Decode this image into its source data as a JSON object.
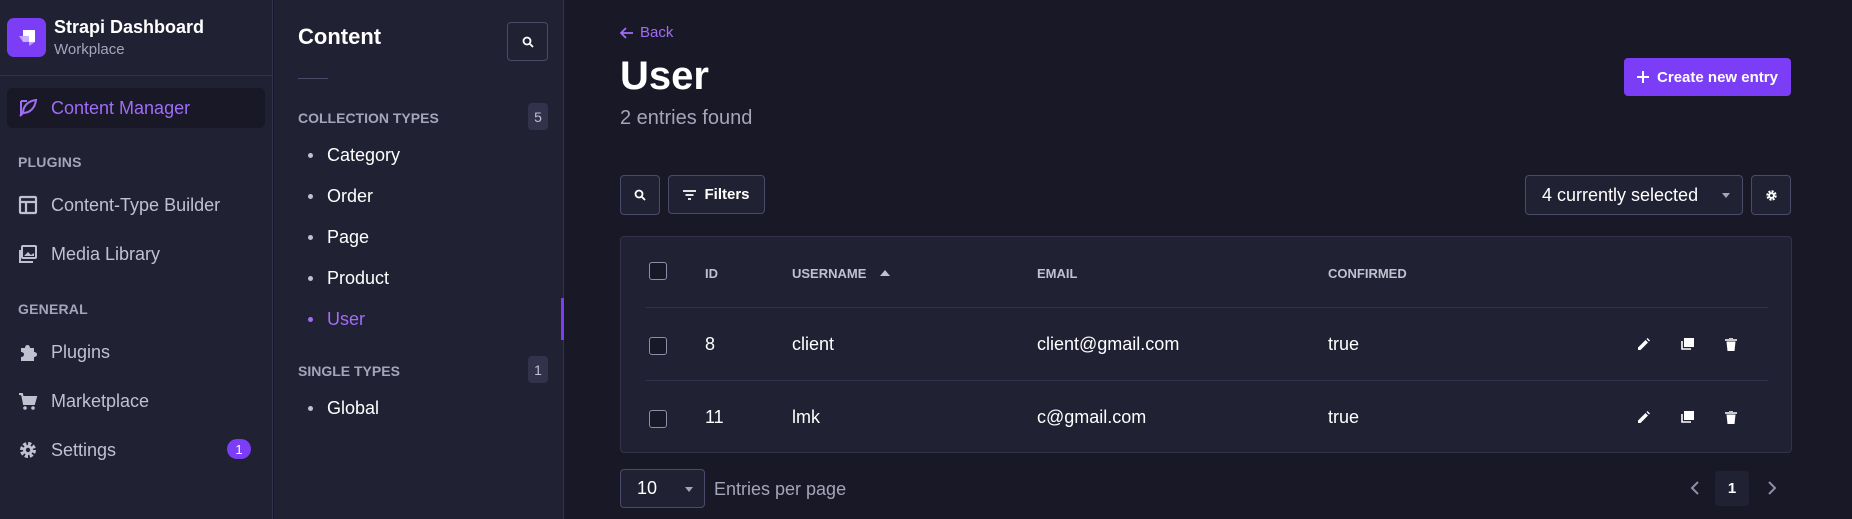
{
  "brand": {
    "title": "Strapi Dashboard",
    "subtitle": "Workplace",
    "logo_icon": "strapi-logo"
  },
  "sidebar": {
    "active": "Content Manager",
    "content_manager": "Content Manager",
    "plugins_label": "PLUGINS",
    "plugins": [
      "Content-Type Builder",
      "Media Library"
    ],
    "general_label": "GENERAL",
    "general": [
      "Plugins",
      "Marketplace",
      "Settings"
    ],
    "settings_badge": "1"
  },
  "subnav": {
    "title": "Content",
    "collection_label": "COLLECTION TYPES",
    "collection_count": "5",
    "collection_items": [
      "Category",
      "Order",
      "Page",
      "Product",
      "User"
    ],
    "active_item": "User",
    "single_label": "SINGLE TYPES",
    "single_count": "1",
    "single_items": [
      "Global"
    ]
  },
  "header": {
    "back_label": "Back",
    "title": "User",
    "subtitle": "2 entries found",
    "create_label": "Create new entry"
  },
  "toolbar": {
    "filters_label": "Filters",
    "columns_selected": "4 currently selected"
  },
  "table": {
    "columns": [
      "ID",
      "USERNAME",
      "EMAIL",
      "CONFIRMED"
    ],
    "sort_column": "USERNAME",
    "sort_direction": "ascending",
    "rows": [
      {
        "id": "8",
        "username": "client",
        "email": "client@gmail.com",
        "confirmed": "true"
      },
      {
        "id": "11",
        "username": "lmk",
        "email": "c@gmail.com",
        "confirmed": "true"
      }
    ]
  },
  "pagination": {
    "per_page": "10",
    "per_page_label": "Entries per page",
    "current_page": "1"
  },
  "colors": {
    "accent": "#7b3df5",
    "accent_text": "#a06cf8",
    "background": "#181826",
    "panel": "#212134",
    "border": "#32324d"
  }
}
